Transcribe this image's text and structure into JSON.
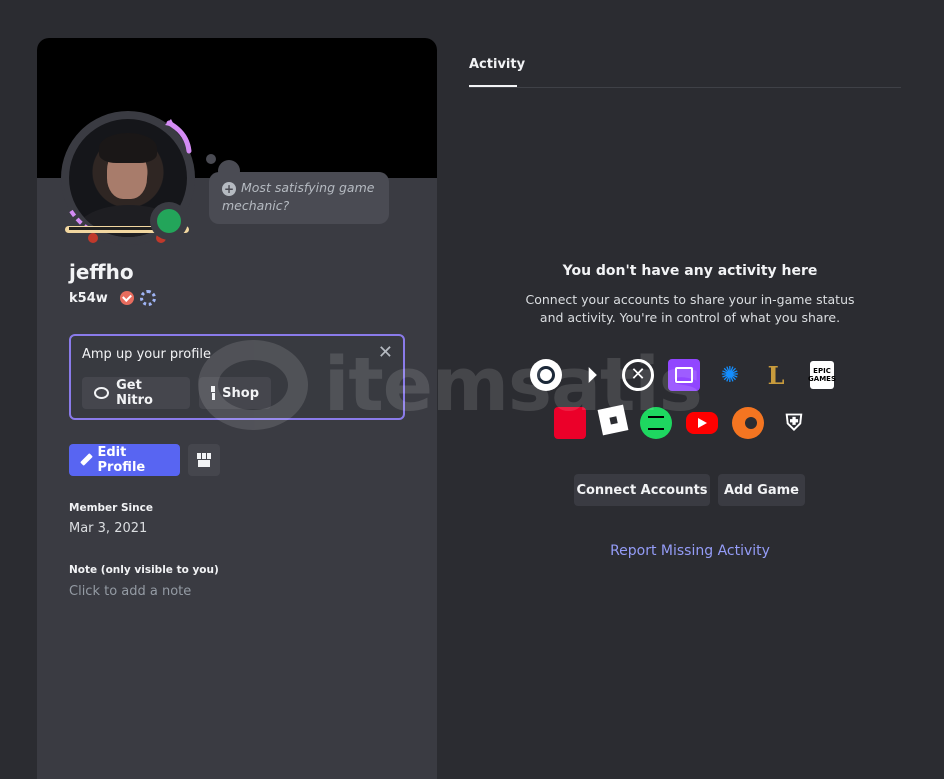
{
  "profile": {
    "display_name": "jeffho",
    "username": "k54w",
    "thought_bubble": "Most satisfying game mechanic?",
    "amp": {
      "title": "Amp up your profile",
      "close": "✕",
      "nitro_label": "Get Nitro",
      "shop_label": "Shop"
    },
    "edit_label": "Edit Profile",
    "member_since_label": "Member Since",
    "member_since_value": "Mar 3, 2021",
    "note_label": "Note (only visible to you)",
    "note_placeholder": "Click to add a note",
    "status_color": "#23a55a"
  },
  "activity": {
    "tab_label": "Activity",
    "empty_title": "You don't have any activity here",
    "empty_desc": "Connect your accounts to share your in-game status and activity. You're in control of what you share.",
    "platforms_row1": [
      "steam-icon",
      "playstation-icon",
      "xbox-icon",
      "twitch-icon",
      "battlenet-icon",
      "league-of-legends-icon",
      "epic-games-icon"
    ],
    "platforms_row2": [
      "riot-games-icon",
      "roblox-icon",
      "spotify-icon",
      "youtube-icon",
      "crunchyroll-icon",
      "bungie-icon"
    ],
    "epic_label": "EPIC GAMES",
    "connect_label": "Connect Accounts",
    "add_game_label": "Add Game",
    "report_label": "Report Missing Activity",
    "link_color": "#949cf7"
  },
  "watermark": {
    "text": "itemsatis"
  },
  "colors": {
    "background": "#2b2c31",
    "card": "#3a3b42",
    "accent": "#5865f2"
  }
}
